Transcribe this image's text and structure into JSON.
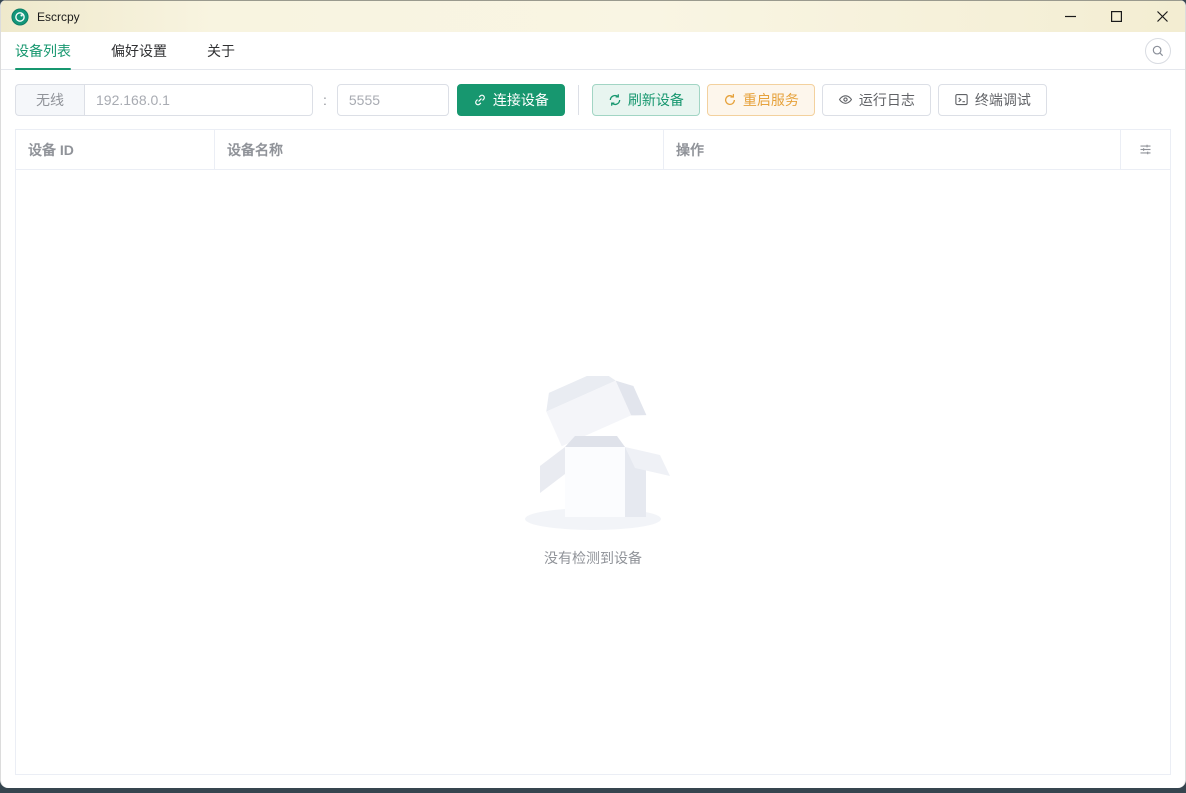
{
  "titlebar": {
    "title": "Escrcpy"
  },
  "tabs": {
    "items": [
      {
        "label": "设备列表",
        "active": true
      },
      {
        "label": "偏好设置",
        "active": false
      },
      {
        "label": "关于",
        "active": false
      }
    ]
  },
  "toolbar": {
    "wireless_label": "无线",
    "ip_value": "192.168.0.1",
    "colon": ":",
    "port_value": "5555",
    "connect_label": "连接设备",
    "refresh_label": "刷新设备",
    "restart_label": "重启服务",
    "log_label": "运行日志",
    "terminal_label": "终端调试"
  },
  "device_table": {
    "columns": [
      {
        "label": "设备 ID"
      },
      {
        "label": "设备名称"
      },
      {
        "label": "操作"
      }
    ]
  },
  "empty_state": {
    "message": "没有检测到设备"
  },
  "colors": {
    "primary": "#17976f",
    "warning": "#e6a23c",
    "titlebar_bg": "#f8f4e0"
  }
}
